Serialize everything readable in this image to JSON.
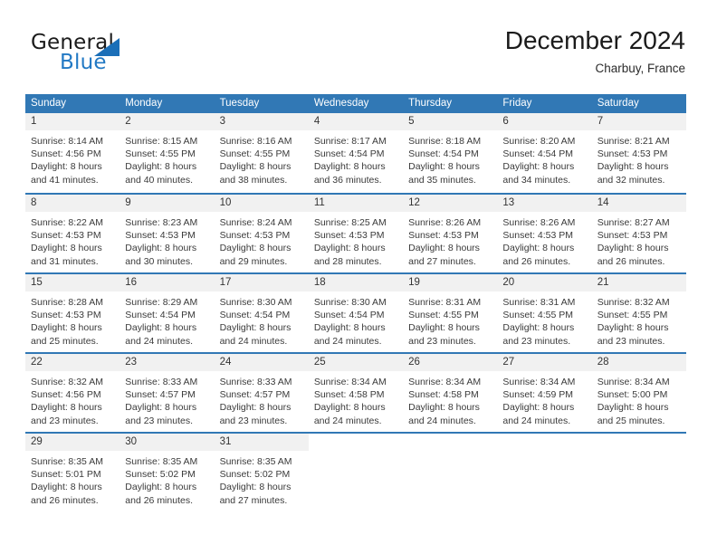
{
  "brand": {
    "word1": "General",
    "word2": "Blue",
    "triangle_color": "#1b6fb8",
    "blue_text_color": "#2279c4"
  },
  "header": {
    "month_title": "December 2024",
    "location": "Charbuy, France"
  },
  "theme": {
    "header_blue": "#3178b5",
    "day_number_bg": "#f1f1f1",
    "text_color": "#3a3a3a"
  },
  "calendar": {
    "weekdays": [
      "Sunday",
      "Monday",
      "Tuesday",
      "Wednesday",
      "Thursday",
      "Friday",
      "Saturday"
    ],
    "weeks": [
      [
        {
          "day": "1",
          "sunrise": "Sunrise: 8:14 AM",
          "sunset": "Sunset: 4:56 PM",
          "daylight1": "Daylight: 8 hours",
          "daylight2": "and 41 minutes."
        },
        {
          "day": "2",
          "sunrise": "Sunrise: 8:15 AM",
          "sunset": "Sunset: 4:55 PM",
          "daylight1": "Daylight: 8 hours",
          "daylight2": "and 40 minutes."
        },
        {
          "day": "3",
          "sunrise": "Sunrise: 8:16 AM",
          "sunset": "Sunset: 4:55 PM",
          "daylight1": "Daylight: 8 hours",
          "daylight2": "and 38 minutes."
        },
        {
          "day": "4",
          "sunrise": "Sunrise: 8:17 AM",
          "sunset": "Sunset: 4:54 PM",
          "daylight1": "Daylight: 8 hours",
          "daylight2": "and 36 minutes."
        },
        {
          "day": "5",
          "sunrise": "Sunrise: 8:18 AM",
          "sunset": "Sunset: 4:54 PM",
          "daylight1": "Daylight: 8 hours",
          "daylight2": "and 35 minutes."
        },
        {
          "day": "6",
          "sunrise": "Sunrise: 8:20 AM",
          "sunset": "Sunset: 4:54 PM",
          "daylight1": "Daylight: 8 hours",
          "daylight2": "and 34 minutes."
        },
        {
          "day": "7",
          "sunrise": "Sunrise: 8:21 AM",
          "sunset": "Sunset: 4:53 PM",
          "daylight1": "Daylight: 8 hours",
          "daylight2": "and 32 minutes."
        }
      ],
      [
        {
          "day": "8",
          "sunrise": "Sunrise: 8:22 AM",
          "sunset": "Sunset: 4:53 PM",
          "daylight1": "Daylight: 8 hours",
          "daylight2": "and 31 minutes."
        },
        {
          "day": "9",
          "sunrise": "Sunrise: 8:23 AM",
          "sunset": "Sunset: 4:53 PM",
          "daylight1": "Daylight: 8 hours",
          "daylight2": "and 30 minutes."
        },
        {
          "day": "10",
          "sunrise": "Sunrise: 8:24 AM",
          "sunset": "Sunset: 4:53 PM",
          "daylight1": "Daylight: 8 hours",
          "daylight2": "and 29 minutes."
        },
        {
          "day": "11",
          "sunrise": "Sunrise: 8:25 AM",
          "sunset": "Sunset: 4:53 PM",
          "daylight1": "Daylight: 8 hours",
          "daylight2": "and 28 minutes."
        },
        {
          "day": "12",
          "sunrise": "Sunrise: 8:26 AM",
          "sunset": "Sunset: 4:53 PM",
          "daylight1": "Daylight: 8 hours",
          "daylight2": "and 27 minutes."
        },
        {
          "day": "13",
          "sunrise": "Sunrise: 8:26 AM",
          "sunset": "Sunset: 4:53 PM",
          "daylight1": "Daylight: 8 hours",
          "daylight2": "and 26 minutes."
        },
        {
          "day": "14",
          "sunrise": "Sunrise: 8:27 AM",
          "sunset": "Sunset: 4:53 PM",
          "daylight1": "Daylight: 8 hours",
          "daylight2": "and 26 minutes."
        }
      ],
      [
        {
          "day": "15",
          "sunrise": "Sunrise: 8:28 AM",
          "sunset": "Sunset: 4:53 PM",
          "daylight1": "Daylight: 8 hours",
          "daylight2": "and 25 minutes."
        },
        {
          "day": "16",
          "sunrise": "Sunrise: 8:29 AM",
          "sunset": "Sunset: 4:54 PM",
          "daylight1": "Daylight: 8 hours",
          "daylight2": "and 24 minutes."
        },
        {
          "day": "17",
          "sunrise": "Sunrise: 8:30 AM",
          "sunset": "Sunset: 4:54 PM",
          "daylight1": "Daylight: 8 hours",
          "daylight2": "and 24 minutes."
        },
        {
          "day": "18",
          "sunrise": "Sunrise: 8:30 AM",
          "sunset": "Sunset: 4:54 PM",
          "daylight1": "Daylight: 8 hours",
          "daylight2": "and 24 minutes."
        },
        {
          "day": "19",
          "sunrise": "Sunrise: 8:31 AM",
          "sunset": "Sunset: 4:55 PM",
          "daylight1": "Daylight: 8 hours",
          "daylight2": "and 23 minutes."
        },
        {
          "day": "20",
          "sunrise": "Sunrise: 8:31 AM",
          "sunset": "Sunset: 4:55 PM",
          "daylight1": "Daylight: 8 hours",
          "daylight2": "and 23 minutes."
        },
        {
          "day": "21",
          "sunrise": "Sunrise: 8:32 AM",
          "sunset": "Sunset: 4:55 PM",
          "daylight1": "Daylight: 8 hours",
          "daylight2": "and 23 minutes."
        }
      ],
      [
        {
          "day": "22",
          "sunrise": "Sunrise: 8:32 AM",
          "sunset": "Sunset: 4:56 PM",
          "daylight1": "Daylight: 8 hours",
          "daylight2": "and 23 minutes."
        },
        {
          "day": "23",
          "sunrise": "Sunrise: 8:33 AM",
          "sunset": "Sunset: 4:57 PM",
          "daylight1": "Daylight: 8 hours",
          "daylight2": "and 23 minutes."
        },
        {
          "day": "24",
          "sunrise": "Sunrise: 8:33 AM",
          "sunset": "Sunset: 4:57 PM",
          "daylight1": "Daylight: 8 hours",
          "daylight2": "and 23 minutes."
        },
        {
          "day": "25",
          "sunrise": "Sunrise: 8:34 AM",
          "sunset": "Sunset: 4:58 PM",
          "daylight1": "Daylight: 8 hours",
          "daylight2": "and 24 minutes."
        },
        {
          "day": "26",
          "sunrise": "Sunrise: 8:34 AM",
          "sunset": "Sunset: 4:58 PM",
          "daylight1": "Daylight: 8 hours",
          "daylight2": "and 24 minutes."
        },
        {
          "day": "27",
          "sunrise": "Sunrise: 8:34 AM",
          "sunset": "Sunset: 4:59 PM",
          "daylight1": "Daylight: 8 hours",
          "daylight2": "and 24 minutes."
        },
        {
          "day": "28",
          "sunrise": "Sunrise: 8:34 AM",
          "sunset": "Sunset: 5:00 PM",
          "daylight1": "Daylight: 8 hours",
          "daylight2": "and 25 minutes."
        }
      ],
      [
        {
          "day": "29",
          "sunrise": "Sunrise: 8:35 AM",
          "sunset": "Sunset: 5:01 PM",
          "daylight1": "Daylight: 8 hours",
          "daylight2": "and 26 minutes."
        },
        {
          "day": "30",
          "sunrise": "Sunrise: 8:35 AM",
          "sunset": "Sunset: 5:02 PM",
          "daylight1": "Daylight: 8 hours",
          "daylight2": "and 26 minutes."
        },
        {
          "day": "31",
          "sunrise": "Sunrise: 8:35 AM",
          "sunset": "Sunset: 5:02 PM",
          "daylight1": "Daylight: 8 hours",
          "daylight2": "and 27 minutes."
        },
        {
          "day": "",
          "sunrise": "",
          "sunset": "",
          "daylight1": "",
          "daylight2": ""
        },
        {
          "day": "",
          "sunrise": "",
          "sunset": "",
          "daylight1": "",
          "daylight2": ""
        },
        {
          "day": "",
          "sunrise": "",
          "sunset": "",
          "daylight1": "",
          "daylight2": ""
        },
        {
          "day": "",
          "sunrise": "",
          "sunset": "",
          "daylight1": "",
          "daylight2": ""
        }
      ]
    ]
  }
}
